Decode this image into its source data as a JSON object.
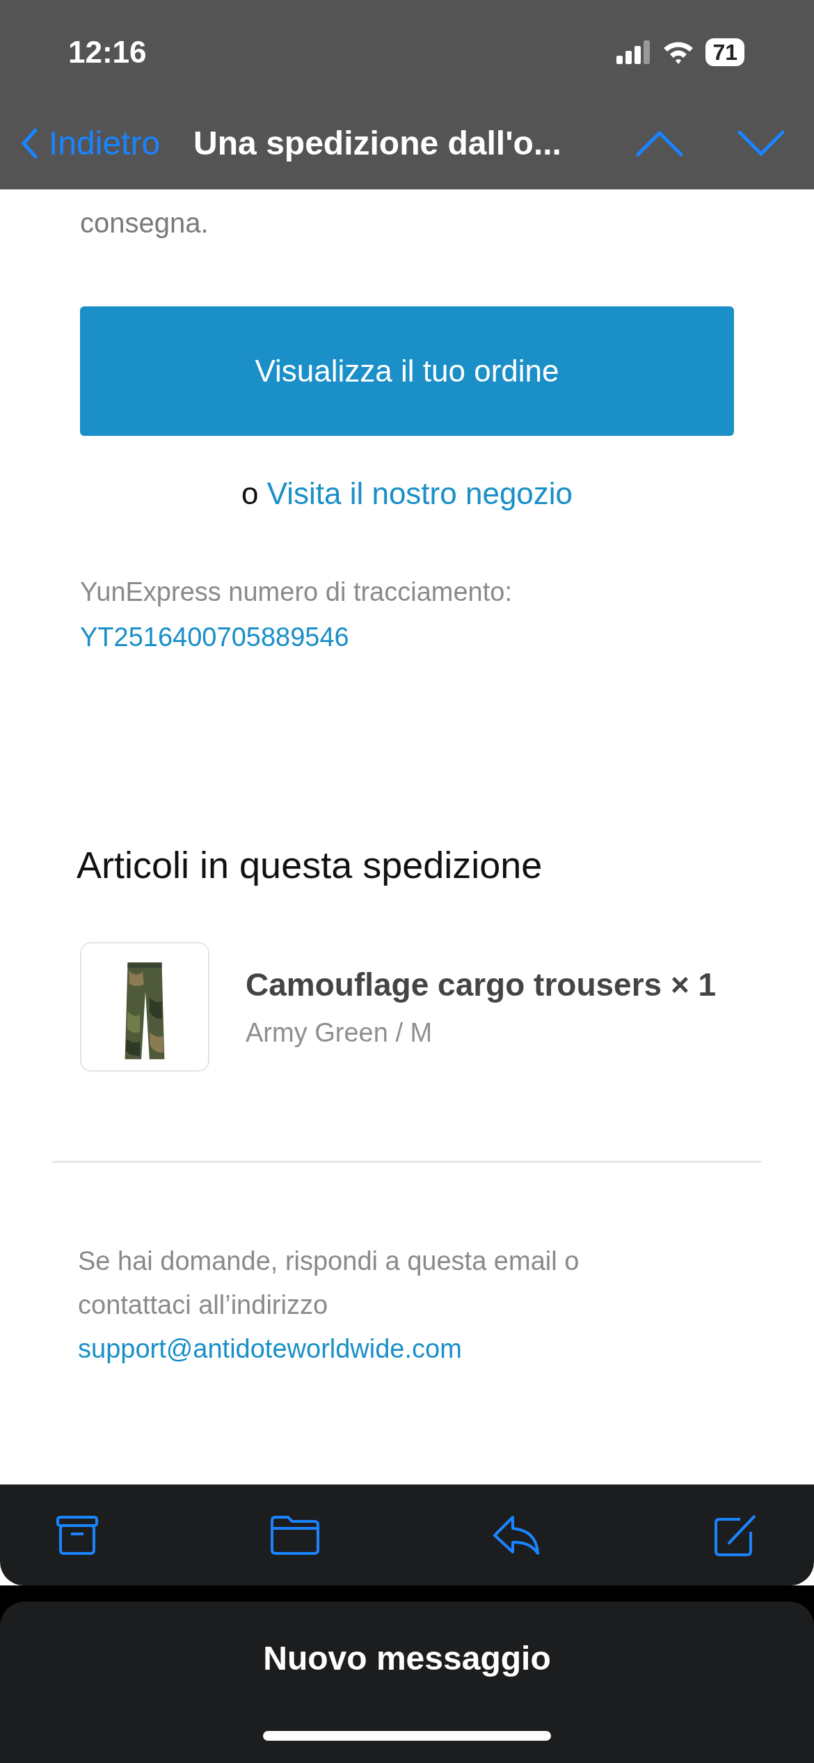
{
  "status_bar": {
    "time": "12:16",
    "battery": "71"
  },
  "nav": {
    "back": "Indietro",
    "title": "Una spedizione dall'o..."
  },
  "body": {
    "intro_tail": "consegna.",
    "button": "Visualizza il tuo ordine",
    "store_prefix": "o",
    "store_link": "Visita il nostro negozio",
    "tracking_label": "YunExpress numero di tracciamento:",
    "tracking_number": "YT2516400705889546"
  },
  "section_title": "Articoli in questa spedizione",
  "items": [
    {
      "kind": "picture",
      "title": "Camouflage cargo trousers × 1",
      "variant": "Army Green / M"
    }
  ],
  "footer": {
    "text": "Se hai domande, rispondi a questa email o contattaci all’indirizzo",
    "email": "support@antidoteworldwide.com"
  },
  "sheet": {
    "title": "Nuovo messaggio"
  }
}
